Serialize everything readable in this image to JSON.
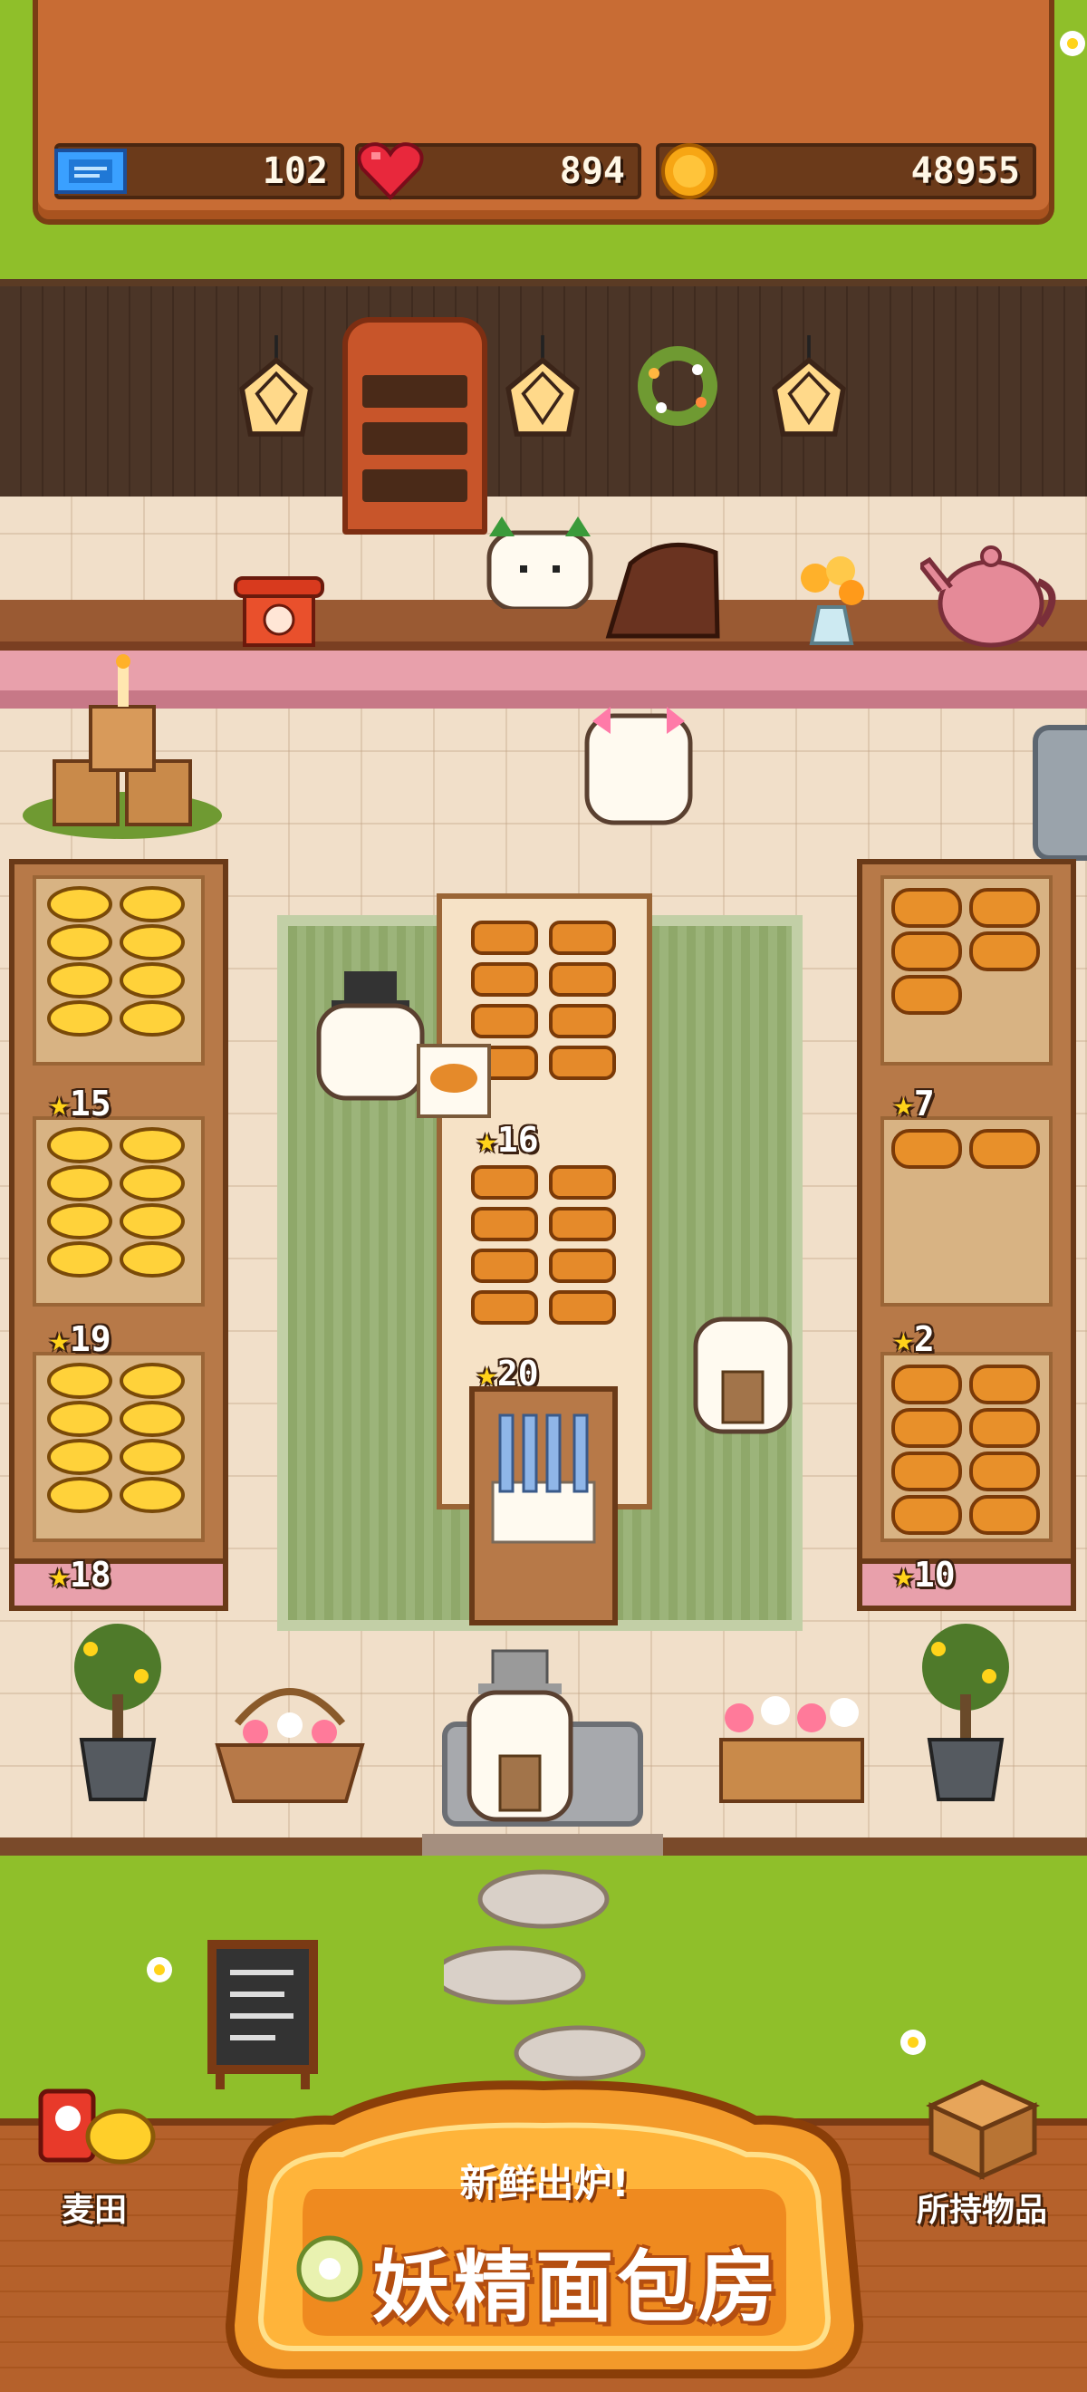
{
  "hud": {
    "tickets": "102",
    "hearts": "894",
    "coins": "48955"
  },
  "shelves": {
    "left": [
      "15",
      "19",
      "18"
    ],
    "center": [
      "16",
      "20"
    ],
    "right": [
      "7",
      "2",
      "10"
    ]
  },
  "bottom": {
    "left_button_label": "麦田",
    "right_button_label": "所持物品",
    "logo_subtitle": "新鲜出炉!",
    "logo_title": "妖精面包房"
  },
  "colors": {
    "grass": "#8fbf2a",
    "wood": "#c86c34",
    "floor": "#f1dfc9",
    "rug": "#9cb47a",
    "star": "#ffd31a"
  },
  "icons": {
    "tickets": "ticket-icon",
    "hearts": "heart-icon",
    "coins": "coin-icon",
    "wheat_field": "wheat-field-icon",
    "inventory": "box-icon"
  }
}
